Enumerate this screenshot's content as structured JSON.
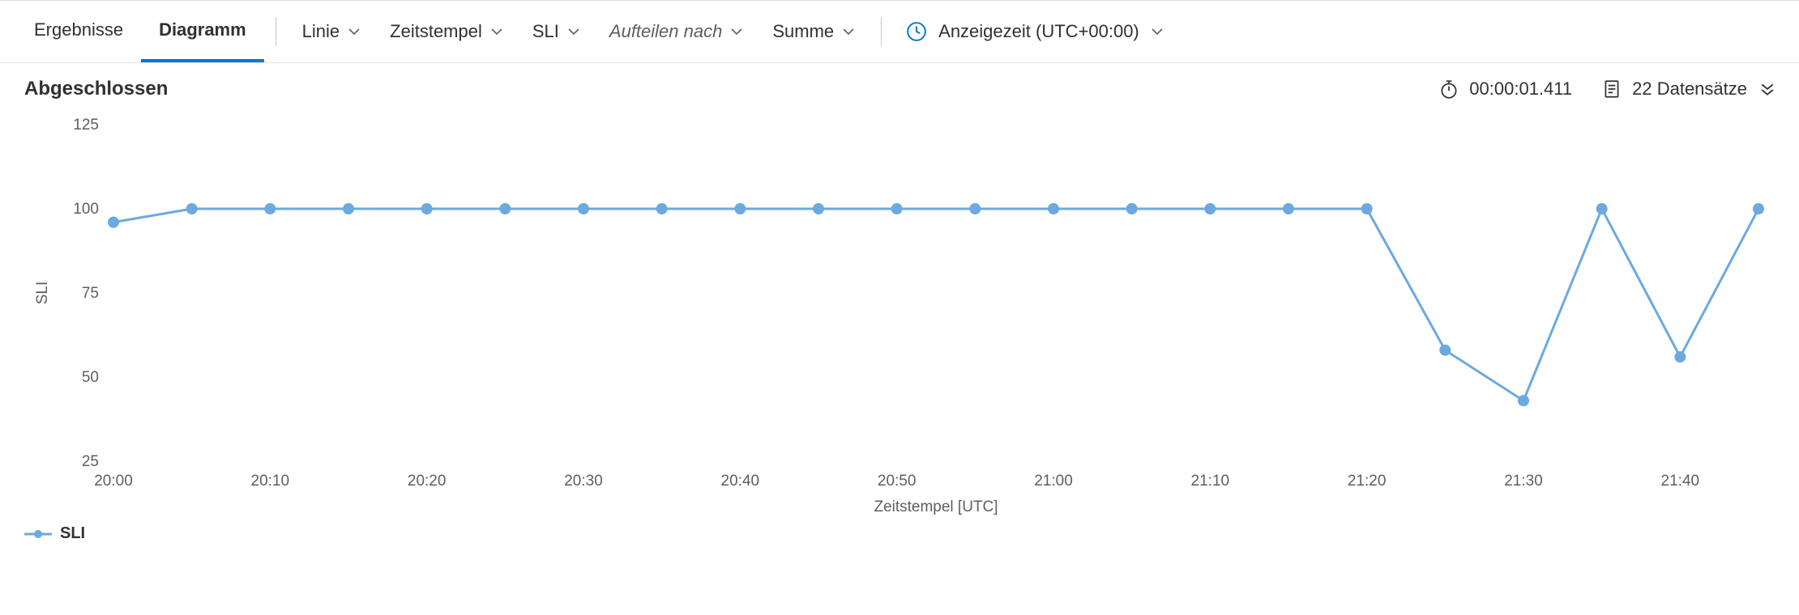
{
  "tabs": {
    "results": "Ergebnisse",
    "diagram": "Diagramm"
  },
  "toolbar": {
    "chart_type": "Linie",
    "x_field": "Zeitstempel",
    "y_field": "SLI",
    "split_by": "Aufteilen nach",
    "aggregation": "Summe",
    "time_display": "Anzeigezeit (UTC+00:00)"
  },
  "status": {
    "completed": "Abgeschlossen",
    "elapsed": "00:00:01.411",
    "records": "22 Datensätze"
  },
  "legend": {
    "series1": "SLI"
  },
  "chart_data": {
    "type": "line",
    "title": "",
    "xlabel": "Zeitstempel [UTC]",
    "ylabel": "SLI",
    "xlim": [
      "20:00",
      "21:45"
    ],
    "ylim": [
      25,
      125
    ],
    "y_ticks": [
      25,
      50,
      75,
      100,
      125
    ],
    "x_ticks": [
      "20:00",
      "20:10",
      "20:20",
      "20:30",
      "20:40",
      "20:50",
      "21:00",
      "21:10",
      "21:20",
      "21:30",
      "21:40"
    ],
    "categories": [
      "20:00",
      "20:05",
      "20:10",
      "20:15",
      "20:20",
      "20:25",
      "20:30",
      "20:35",
      "20:40",
      "20:45",
      "20:50",
      "20:55",
      "21:00",
      "21:05",
      "21:10",
      "21:15",
      "21:20",
      "21:25",
      "21:30",
      "21:35",
      "21:40",
      "21:45"
    ],
    "series": [
      {
        "name": "SLI",
        "color": "#6ca9e0",
        "values": [
          96,
          100,
          100,
          100,
          100,
          100,
          100,
          100,
          100,
          100,
          100,
          100,
          100,
          100,
          100,
          100,
          100,
          58,
          43,
          100,
          56,
          100
        ]
      }
    ],
    "grid": false,
    "legend_position": "bottom-left"
  }
}
